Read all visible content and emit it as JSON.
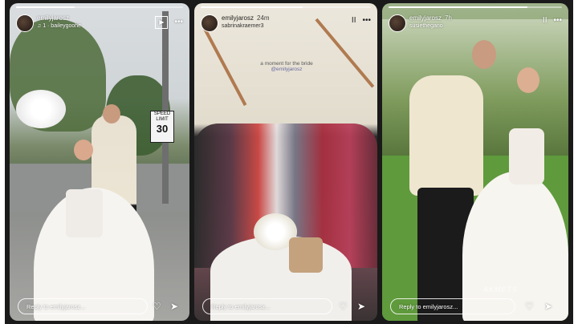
{
  "colors": {
    "frame": "#1a1a1a",
    "text": "#ffffff",
    "caption_tag": "#6a6aa0"
  },
  "stories": [
    {
      "username": "emilyjarosz",
      "time": "",
      "subtext": "♫ 1 · baileygoohe",
      "progress": 0.35,
      "controls": {
        "play": "▶",
        "more": "•••"
      },
      "reply_placeholder": "Reply to emilyjarosz...",
      "sign": {
        "line1": "SPEED",
        "line2": "LIMIT",
        "value": "30"
      }
    },
    {
      "username": "emilyjarosz",
      "time": "24m",
      "subtext": "sabrinakraemer3",
      "progress": 0.6,
      "controls": {
        "pause": "II",
        "more": "•••"
      },
      "caption_text": "a moment for the bride",
      "caption_tag": "@emilyjarosz",
      "reply_placeholder": "Reply to emilyjarosz..."
    },
    {
      "username": "emilyjarosz",
      "time": "7h",
      "subtext": "susiethegano",
      "progress": 0.8,
      "controls": {
        "pause": "II",
        "more": "•••"
      },
      "watermark": "AKMETS",
      "reply_placeholder": "Reply to emilyjarosz..."
    }
  ],
  "icons": {
    "heart": "heart-icon",
    "send": "send-icon"
  }
}
